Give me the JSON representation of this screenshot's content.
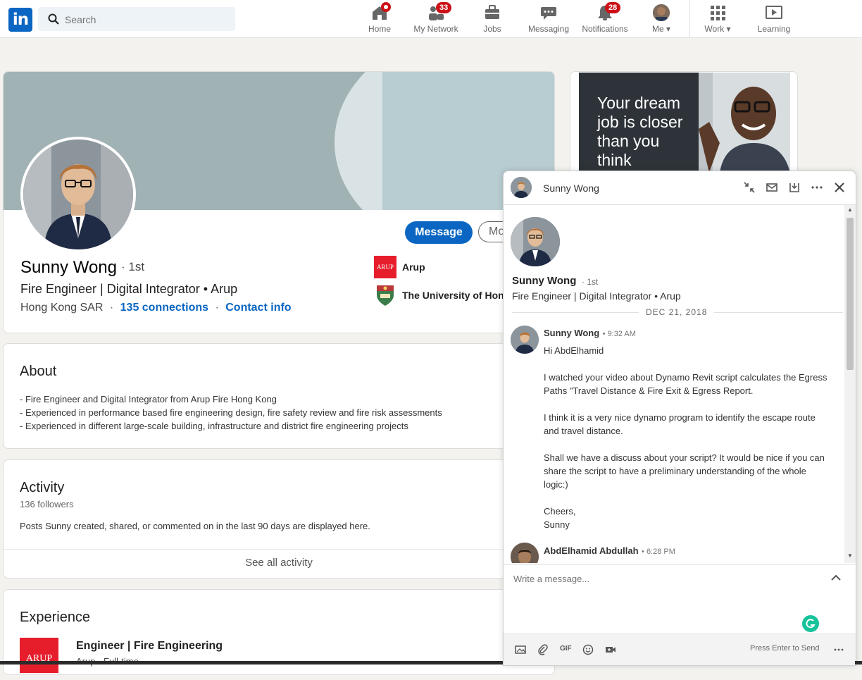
{
  "nav": {
    "search_placeholder": "Search",
    "items": [
      {
        "label": "Home",
        "badge": ""
      },
      {
        "label": "My Network",
        "badge": "33"
      },
      {
        "label": "Jobs",
        "badge": ""
      },
      {
        "label": "Messaging",
        "badge": ""
      },
      {
        "label": "Notifications",
        "badge": "28"
      },
      {
        "label": "Me",
        "badge": ""
      },
      {
        "label": "Work",
        "badge": ""
      },
      {
        "label": "Learning",
        "badge": ""
      }
    ],
    "brand_color": "#0a66c2"
  },
  "profile": {
    "name": "Sunny Wong",
    "degree": "· 1st",
    "headline": "Fire Engineer | Digital Integrator • Arup",
    "location": "Hong Kong SAR",
    "sep1": "·",
    "connections": "135 connections",
    "sep2": "·",
    "contact_info": "Contact info",
    "message_button": "Message",
    "more_button": "Mo",
    "companies": [
      {
        "logo_text": "ARUP",
        "name": "Arup"
      },
      {
        "name": "The University of Hong"
      }
    ]
  },
  "about": {
    "title": "About",
    "lines": [
      "- Fire Engineer and Digital Integrator from Arup Fire Hong Kong",
      "- Experienced in performance based fire engineering design, fire safety review and fire risk assessments",
      "- Experienced in different large-scale building, infrastructure and district fire engineering projects"
    ]
  },
  "activity": {
    "title": "Activity",
    "followers": "136 followers",
    "description": "Posts Sunny created, shared, or commented on in the last 90 days are displayed here.",
    "see_all": "See all activity"
  },
  "experience": {
    "title": "Experience",
    "logo_text": "ARUP",
    "role": "Engineer | Fire Engineering",
    "sub": "Arup · Full-time"
  },
  "ad": {
    "text": "Your dream job is closer than you think"
  },
  "chat": {
    "header_name": "Sunny Wong",
    "profile_name": "Sunny Wong",
    "profile_degree": "· 1st",
    "profile_headline": "Fire Engineer | Digital Integrator • Arup",
    "date_divider": "DEC 21, 2018",
    "messages": [
      {
        "sender": "Sunny Wong",
        "time": "• 9:32 AM",
        "paragraphs": [
          "Hi AbdElhamid",
          "I watched your video about Dynamo Revit script calculates the Egress Paths \"Travel Distance & Fire Exit & Egress Report.",
          "I think it is a very nice dynamo program to identify the escape route and travel distance.",
          "Shall we have a discuss about your script? It would be nice if you can share the script to have a preliminary understanding of the whole logic:)",
          "Cheers,",
          "Sunny"
        ]
      },
      {
        "sender": "AbdElhamid Abdullah",
        "time": "• 6:28 PM"
      }
    ],
    "composer_placeholder": "Write a message...",
    "press_enter": "Press Enter to Send",
    "gif_label": "GIF"
  }
}
